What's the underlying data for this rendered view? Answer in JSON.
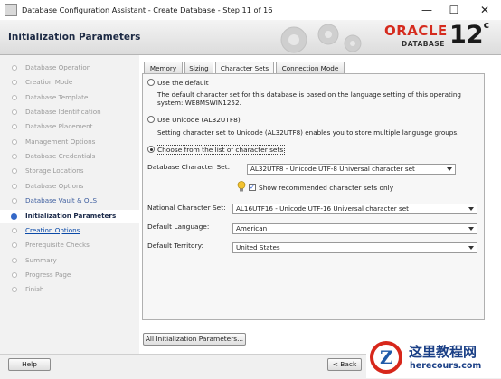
{
  "window": {
    "title": "Database Configuration Assistant - Create Database - Step 11 of 16",
    "controls": {
      "minimize": "—",
      "maximize": "☐",
      "close": "✕"
    }
  },
  "header": {
    "page_title": "Initialization Parameters",
    "logo_brand": "ORACLE",
    "logo_sub": "DATABASE",
    "logo_version": "12",
    "logo_version_sup": "c"
  },
  "steps": [
    {
      "label": "Database Operation",
      "state": "disabled"
    },
    {
      "label": "Creation Mode",
      "state": "disabled"
    },
    {
      "label": "Database Template",
      "state": "disabled"
    },
    {
      "label": "Database Identification",
      "state": "disabled"
    },
    {
      "label": "Database Placement",
      "state": "disabled"
    },
    {
      "label": "Management Options",
      "state": "disabled"
    },
    {
      "label": "Database Credentials",
      "state": "disabled"
    },
    {
      "label": "Storage Locations",
      "state": "disabled"
    },
    {
      "label": "Database Options",
      "state": "disabled"
    },
    {
      "label": "Database Vault & OLS",
      "state": "done"
    },
    {
      "label": "Initialization Parameters",
      "state": "current"
    },
    {
      "label": "Creation Options",
      "state": "link"
    },
    {
      "label": "Prerequisite Checks",
      "state": "disabled"
    },
    {
      "label": "Summary",
      "state": "disabled"
    },
    {
      "label": "Progress Page",
      "state": "disabled"
    },
    {
      "label": "Finish",
      "state": "disabled"
    }
  ],
  "tabs": [
    {
      "label": "Memory",
      "active": false
    },
    {
      "label": "Sizing",
      "active": false
    },
    {
      "label": "Character Sets",
      "active": true
    },
    {
      "label": "Connection Mode",
      "active": false
    }
  ],
  "charset": {
    "option_default": {
      "label": "Use the default",
      "description": "The default character set for this database is based on the language setting of this operating system: WE8MSWIN1252."
    },
    "option_unicode": {
      "label": "Use Unicode (AL32UTF8)",
      "description": "Setting character set to Unicode (AL32UTF8) enables you to store multiple language groups."
    },
    "option_list": {
      "label": "Choose from the list of character sets",
      "selected": true
    },
    "db_charset_label": "Database Character Set:",
    "db_charset_value": "AL32UTF8 - Unicode UTF-8 Universal character set",
    "show_recommended_label": "Show recommended character sets only",
    "show_recommended_checked": true,
    "national_label": "National Character Set:",
    "national_value": "AL16UTF16 - Unicode UTF-16 Universal character set",
    "language_label": "Default Language:",
    "language_value": "American",
    "territory_label": "Default Territory:",
    "territory_value": "United States"
  },
  "buttons": {
    "all_params": "All Initialization Parameters...",
    "help": "Help",
    "back": "< Back"
  },
  "watermark": {
    "cn": "这里教程网",
    "url": "herecours.com"
  },
  "colors": {
    "oracle_red": "#d52b1e",
    "link_blue": "#0b4aa8",
    "current_step": "#3468c8"
  }
}
